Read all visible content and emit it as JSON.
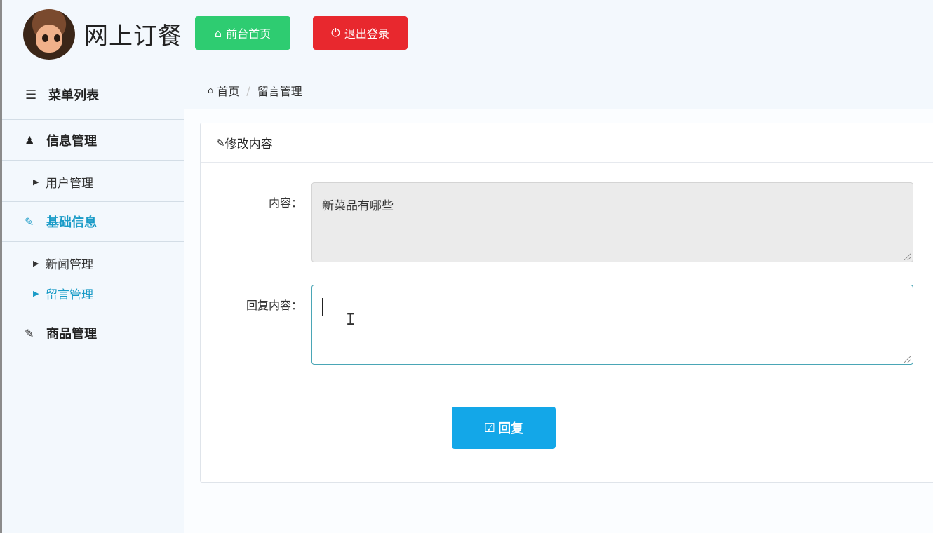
{
  "header": {
    "app_title": "网上订餐",
    "home_button": "前台首页",
    "logout_button": "退出登录"
  },
  "sidebar": {
    "title": "菜单列表",
    "groups": [
      {
        "label": "信息管理",
        "items": [
          "用户管理"
        ]
      },
      {
        "label": "基础信息",
        "items": [
          "新闻管理",
          "留言管理"
        ]
      },
      {
        "label": "商品管理",
        "items": []
      }
    ]
  },
  "breadcrumb": {
    "home": "首页",
    "current": "留言管理"
  },
  "panel": {
    "title": "修改内容",
    "content_label": "内容：",
    "content_value": "新菜品有哪些",
    "reply_label": "回复内容：",
    "reply_value": "",
    "submit_button": "回复"
  },
  "colors": {
    "home_button": "#2ecc71",
    "logout_button": "#e8282e",
    "active_menu": "#1a9bc7",
    "reply_button": "#13a7e8"
  },
  "icons": {
    "home": "home-icon",
    "power": "power-icon",
    "list": "list-icon",
    "user": "user-icon",
    "edit": "edit-icon",
    "check": "check-square-icon"
  }
}
